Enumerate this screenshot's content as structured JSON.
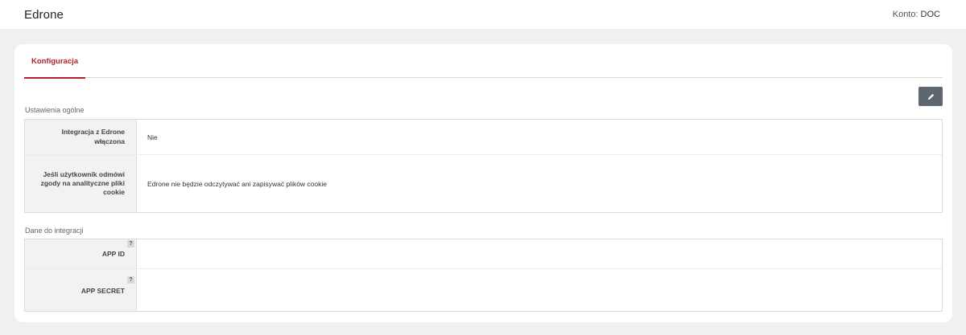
{
  "header": {
    "title": "Edrone",
    "account_label": "Konto:",
    "account_value": "DOC"
  },
  "tabs": [
    {
      "label": "Konfiguracja",
      "active": true
    }
  ],
  "toolbar": {
    "edit_icon": "pencil-icon"
  },
  "general": {
    "section_title": "Ustawienia ogólne",
    "rows": [
      {
        "label": "Integracja z Edrone włączona",
        "value": "Nie"
      },
      {
        "label": "Jeśli użytkownik odmówi zgody na analityczne pliki cookie",
        "value": "Edrone nie będzie odczytywać ani zapisywać plików cookie"
      }
    ]
  },
  "integration": {
    "section_title": "Dane do integracji",
    "help_glyph": "?",
    "rows": [
      {
        "label": "APP ID",
        "value": ""
      },
      {
        "label": "APP SECRET",
        "value": ""
      }
    ]
  },
  "colors": {
    "accent": "#b3202a",
    "edit_button": "#5e6670",
    "page_bg": "#eef0f2"
  }
}
